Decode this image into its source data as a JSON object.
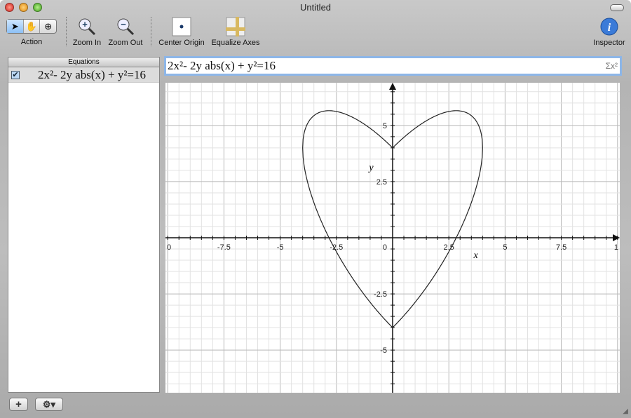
{
  "window": {
    "title": "Untitled"
  },
  "toolbar": {
    "action_label": "Action",
    "zoom_in_label": "Zoom In",
    "zoom_out_label": "Zoom Out",
    "center_origin_label": "Center Origin",
    "equalize_axes_label": "Equalize Axes",
    "inspector_label": "Inspector",
    "selected_tool": "arrow"
  },
  "equations_panel": {
    "header": "Equations",
    "items": [
      {
        "checked": true,
        "equation": "2x²- 2y abs(x) + y²=16"
      }
    ]
  },
  "equation_field": {
    "value": "2x²- 2y abs(x) + y²=16",
    "sigma_icon": "Σx²"
  },
  "chart_data": {
    "type": "line",
    "equation": "2x^2 - 2y abs(x) + y^2 = 16",
    "xlim": [
      -10.1,
      10.1
    ],
    "ylim": [
      -6.9,
      6.9
    ],
    "x_ticks": [
      "0",
      "-7.5",
      "-5",
      "-2.5",
      "0",
      "2.5",
      "5",
      "7.5",
      "1"
    ],
    "y_ticks": [
      "5",
      "2.5",
      "-2.5",
      "-5"
    ],
    "xlabel": "x",
    "ylabel": "y",
    "grid": true,
    "curve_color": "#222222"
  },
  "bottom": {
    "add_label": "+",
    "gear_label": "⚙▾"
  }
}
